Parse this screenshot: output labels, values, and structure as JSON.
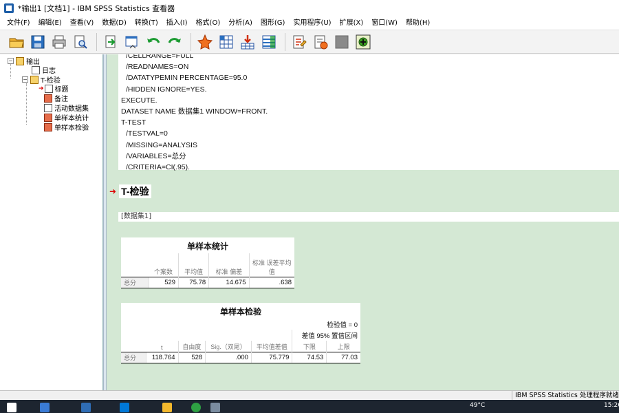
{
  "window": {
    "title": "*输出1 [文档1] - IBM SPSS Statistics 查看器"
  },
  "menu": [
    "文件(F)",
    "编辑(E)",
    "查看(V)",
    "数据(D)",
    "转换(T)",
    "插入(I)",
    "格式(O)",
    "分析(A)",
    "图形(G)",
    "实用程序(U)",
    "扩展(X)",
    "窗口(W)",
    "帮助(H)"
  ],
  "toolbar": {
    "icons": [
      "open-icon",
      "save-icon",
      "print-icon",
      "print-preview-icon",
      "export-icon",
      "recall-dialog-icon",
      "undo-icon",
      "redo-icon",
      "goto-data-icon",
      "goto-case-icon",
      "goto-variable-icon",
      "variables-icon",
      "designate-window-icon",
      "script-icon",
      "disabled-icon",
      "add-icon"
    ]
  },
  "outline": {
    "root": "输出",
    "log": "日志",
    "ttest": "T-检验",
    "children": [
      "标题",
      "备注",
      "活动数据集",
      "单样本统计",
      "单样本检验"
    ]
  },
  "log": {
    "lines": [
      " /CELLRANGE=FULL",
      " /READNAMES=ON",
      " /DATATYPEMIN PERCENTAGE=95.0",
      " /HIDDEN IGNORE=YES.",
      "EXECUTE.",
      "DATASET NAME 数据集1 WINDOW=FRONT.",
      "T-TEST",
      " /TESTVAL=0",
      " /MISSING=ANALYSIS",
      " /VARIABLES=总分",
      " /CRITERIA=CI(.95)."
    ]
  },
  "section": {
    "heading": "T-检验",
    "dataset": "[数据集1]"
  },
  "table1": {
    "title": "单样本统计",
    "headers": [
      "个案数",
      "平均值",
      "标准 偏差",
      "标准 误差平均值"
    ],
    "row_label": "总分",
    "values": [
      "529",
      "75.78",
      "14.675",
      ".638"
    ]
  },
  "table2": {
    "title": "单样本检验",
    "subtitle": "检验值 = 0",
    "ci_header": "差值 95% 置信区间",
    "headers": [
      "t",
      "自由度",
      "Sig.（双尾）",
      "平均值差值",
      "下限",
      "上限"
    ],
    "row_label": "总分",
    "values": [
      "118.764",
      "528",
      ".000",
      "75.779",
      "74.53",
      "77.03"
    ]
  },
  "status": {
    "text": "IBM SPSS Statistics 处理程序就绪"
  },
  "taskbar": {
    "temperature": "49°C",
    "clock": "15:26"
  },
  "colors": {
    "content_bg": "#d4e8d4",
    "accent": "#1f5fa8",
    "arrow": "#dd0000"
  }
}
